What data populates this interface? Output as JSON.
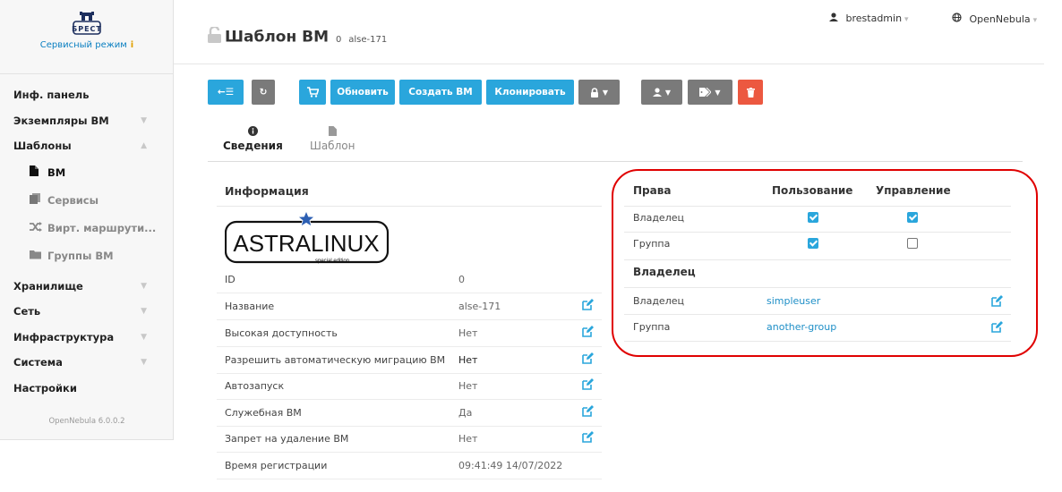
{
  "sidebar": {
    "logo_text": "БРЕСТ",
    "service_mode": "Сервисный режим",
    "service_mode_icon": "i",
    "items": [
      {
        "label": "Инф. панель",
        "chevron": ""
      },
      {
        "label": "Экземпляры ВМ",
        "chevron": "▼"
      },
      {
        "label": "Шаблоны",
        "chevron": "▲"
      },
      {
        "label": "ВМ",
        "sub": true,
        "active": true,
        "icon": "file-icon"
      },
      {
        "label": "Сервисы",
        "sub": true,
        "icon": "files-icon"
      },
      {
        "label": "Вирт. маршрути...",
        "sub": true,
        "icon": "shuffle-icon"
      },
      {
        "label": "Группы ВМ",
        "sub": true,
        "icon": "folder-icon"
      },
      {
        "label": "Хранилище",
        "chevron": "▼"
      },
      {
        "label": "Сеть",
        "chevron": "▼"
      },
      {
        "label": "Инфраструктура",
        "chevron": "▼"
      },
      {
        "label": "Система",
        "chevron": "▼"
      },
      {
        "label": "Настройки",
        "chevron": ""
      }
    ],
    "version": "OpenNebula 6.0.0.2"
  },
  "header": {
    "title": "Шаблон ВМ",
    "id": "0",
    "name": "alse-171",
    "user": "brestadmin",
    "zone": "OpenNebula",
    "dropdown_glyph": "▾"
  },
  "toolbar": {
    "back_label": "←☰",
    "refresh_label": "↻",
    "cart_label": "🛒",
    "update_label": "Обновить",
    "create_vm_label": "Создать ВМ",
    "clone_label": "Клонировать",
    "caret": "▼"
  },
  "tabs": [
    {
      "label": "Сведения",
      "icon": "info-circle-icon",
      "glyph": "❶"
    },
    {
      "label": "Шаблон",
      "icon": "file-icon",
      "glyph": "▮"
    }
  ],
  "info": {
    "title": "Информация",
    "brand": {
      "text": "ASTRALINUX",
      "subtext": "special edition"
    },
    "rows": [
      {
        "key": "ID",
        "value": "0",
        "editable": false
      },
      {
        "key": "Название",
        "value": "alse-171",
        "editable": true
      },
      {
        "key": "Высокая доступность",
        "value": "Нет",
        "editable": true
      },
      {
        "key": "Разрешить автоматическую миграцию ВМ",
        "value": "Нет",
        "editable": true,
        "dark": true
      },
      {
        "key": "Автозапуск",
        "value": "Нет",
        "editable": true
      },
      {
        "key": "Служебная ВМ",
        "value": "Да",
        "editable": true
      },
      {
        "key": "Запрет на удаление ВМ",
        "value": "Нет",
        "editable": true
      },
      {
        "key": "Время регистрации",
        "value": "09:41:49 14/07/2022",
        "editable": false
      }
    ]
  },
  "permissions": {
    "title": "Права",
    "col_use": "Пользование",
    "col_manage": "Управление",
    "rows": [
      {
        "label": "Владелец",
        "use": true,
        "manage": true
      },
      {
        "label": "Группа",
        "use": true,
        "manage": false
      }
    ],
    "owner_title": "Владелец",
    "owner_rows": [
      {
        "label": "Владелец",
        "value": "simpleuser"
      },
      {
        "label": "Группа",
        "value": "another-group"
      }
    ]
  },
  "colors": {
    "accent": "#2aa6dc",
    "gray_button": "#7a7a7a",
    "danger": "#ec5840",
    "highlight": "#e00000",
    "link": "#1f8fc7"
  }
}
